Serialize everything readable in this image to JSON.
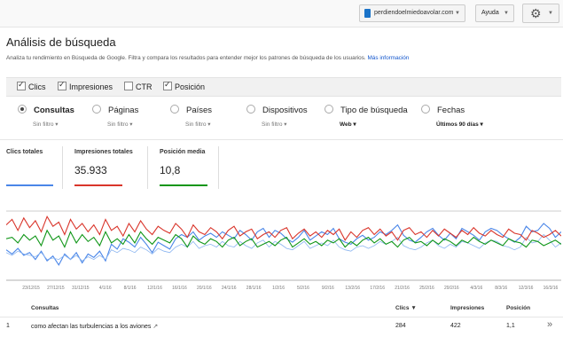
{
  "topbar": {
    "site": "perdiendoelmiedoavolar.com",
    "help": "Ayuda"
  },
  "page": {
    "title": "Análisis de búsqueda",
    "description": "Analiza tu rendimiento en Búsqueda de Google. Filtra y compara los resultados para entender mejor los patrones de búsqueda de los usuarios.",
    "more_info": "Más información"
  },
  "metrics": [
    {
      "label": "Clics",
      "checked": true
    },
    {
      "label": "Impresiones",
      "checked": true
    },
    {
      "label": "CTR",
      "checked": false
    },
    {
      "label": "Posición",
      "checked": true
    }
  ],
  "dimensions": [
    {
      "label": "Consultas",
      "selected": true,
      "filter": "Sin filtro"
    },
    {
      "label": "Páginas",
      "selected": false,
      "filter": "Sin filtro"
    },
    {
      "label": "Países",
      "selected": false,
      "filter": "Sin filtro"
    },
    {
      "label": "Dispositivos",
      "selected": false,
      "filter": "Sin filtro"
    },
    {
      "label": "Tipo de búsqueda",
      "selected": false,
      "filter": "Web"
    },
    {
      "label": "Fechas",
      "selected": false,
      "filter": "Últimos 90 días"
    }
  ],
  "totals": {
    "clicks_label": "Clics totales",
    "clicks_value": "",
    "impressions_label": "Impresiones totales",
    "impressions_value": "35.933",
    "position_label": "Posición media",
    "position_value": "10,8"
  },
  "colors": {
    "clicks": "#4a86e8",
    "impressions": "#d9352b",
    "position": "#109618"
  },
  "chart_data": {
    "type": "line",
    "x_tick_labels": [
      "23/12/15",
      "27/12/15",
      "31/12/15",
      "4/1/16",
      "8/1/16",
      "12/1/16",
      "16/1/16",
      "20/1/16",
      "24/1/16",
      "28/1/16",
      "1/2/16",
      "5/2/16",
      "9/2/16",
      "13/2/16",
      "17/2/16",
      "21/2/16",
      "25/2/16",
      "29/2/16",
      "4/3/16",
      "8/3/16",
      "12/3/16",
      "16/3/16"
    ],
    "series": [
      {
        "values": [
          44,
          38,
          46,
          36,
          40,
          30,
          42,
          28,
          35,
          22,
          38,
          30,
          40,
          25,
          38,
          33,
          42,
          28,
          52,
          45,
          60,
          55,
          48,
          62,
          52,
          40,
          55,
          50,
          45,
          60,
          66,
          62,
          70,
          58,
          64,
          68,
          62,
          70,
          65,
          60,
          72,
          66,
          58,
          70,
          75,
          62,
          72,
          68,
          60,
          55,
          62,
          72,
          58,
          64,
          70,
          66,
          75,
          60,
          55,
          52,
          60,
          65,
          58,
          62,
          70,
          66,
          72,
          80,
          65,
          58,
          55,
          62,
          70,
          75,
          65,
          58,
          68,
          60,
          75,
          70,
          65,
          58,
          70,
          75,
          72,
          65,
          60,
          55,
          62,
          78,
          70,
          72,
          82,
          75,
          62,
          70
        ]
      },
      {
        "values": [
          40,
          36,
          42,
          38,
          36,
          34,
          40,
          30,
          32,
          30,
          36,
          30,
          36,
          28,
          34,
          30,
          36,
          30,
          44,
          40,
          46,
          44,
          40,
          48,
          44,
          38,
          46,
          42,
          40,
          48,
          52,
          48,
          56,
          46,
          50,
          52,
          48,
          56,
          50,
          48,
          56,
          50,
          46,
          54,
          58,
          48,
          56,
          52,
          46,
          44,
          50,
          56,
          46,
          50,
          54,
          50,
          58,
          48,
          44,
          42,
          48,
          50,
          46,
          50,
          56,
          52,
          56,
          62,
          50,
          46,
          44,
          48,
          54,
          58,
          50,
          46,
          52,
          48,
          56,
          54,
          50,
          46,
          54,
          58,
          56,
          50,
          48,
          44,
          48,
          62,
          54,
          56,
          66,
          58,
          48,
          54
        ]
      },
      {
        "values": [
          60,
          62,
          54,
          66,
          58,
          64,
          50,
          72,
          58,
          64,
          48,
          70,
          54,
          66,
          56,
          62,
          50,
          70,
          54,
          60,
          52,
          66,
          54,
          70,
          60,
          52,
          62,
          58,
          54,
          66,
          60,
          48,
          64,
          56,
          52,
          60,
          56,
          48,
          58,
          62,
          50,
          56,
          60,
          48,
          52,
          56,
          50,
          58,
          62,
          48,
          54,
          60,
          52,
          56,
          50,
          58,
          54,
          60,
          48,
          56,
          50,
          58,
          62,
          54,
          60,
          52,
          56,
          48,
          58,
          62,
          54,
          56,
          50,
          58,
          52,
          60,
          56,
          50,
          58,
          54,
          62,
          56,
          52,
          58,
          54,
          50,
          60,
          56,
          54,
          48,
          58,
          56,
          50,
          54,
          58,
          52
        ]
      },
      {
        "values": [
          80,
          88,
          72,
          90,
          76,
          86,
          70,
          92,
          78,
          84,
          66,
          88,
          74,
          82,
          70,
          80,
          66,
          88,
          72,
          78,
          64,
          82,
          70,
          86,
          74,
          66,
          78,
          72,
          68,
          82,
          74,
          62,
          80,
          70,
          66,
          76,
          70,
          60,
          72,
          78,
          64,
          70,
          74,
          60,
          66,
          70,
          62,
          72,
          76,
          60,
          68,
          74,
          64,
          70,
          62,
          72,
          66,
          74,
          58,
          70,
          62,
          72,
          76,
          66,
          74,
          64,
          70,
          58,
          72,
          76,
          66,
          70,
          62,
          72,
          64,
          74,
          68,
          62,
          72,
          66,
          76,
          68,
          64,
          72,
          66,
          62,
          74,
          68,
          66,
          58,
          72,
          68,
          62,
          66,
          72,
          64
        ]
      }
    ]
  },
  "table": {
    "col_query": "Consultas",
    "col_clicks": "Clics ▼",
    "col_impressions": "Impresiones",
    "col_position": "Posición",
    "rows": [
      {
        "index": "1",
        "query": "como afectan las turbulencias a los aviones",
        "clicks": "284",
        "impressions": "422",
        "position": "1,1"
      }
    ]
  }
}
